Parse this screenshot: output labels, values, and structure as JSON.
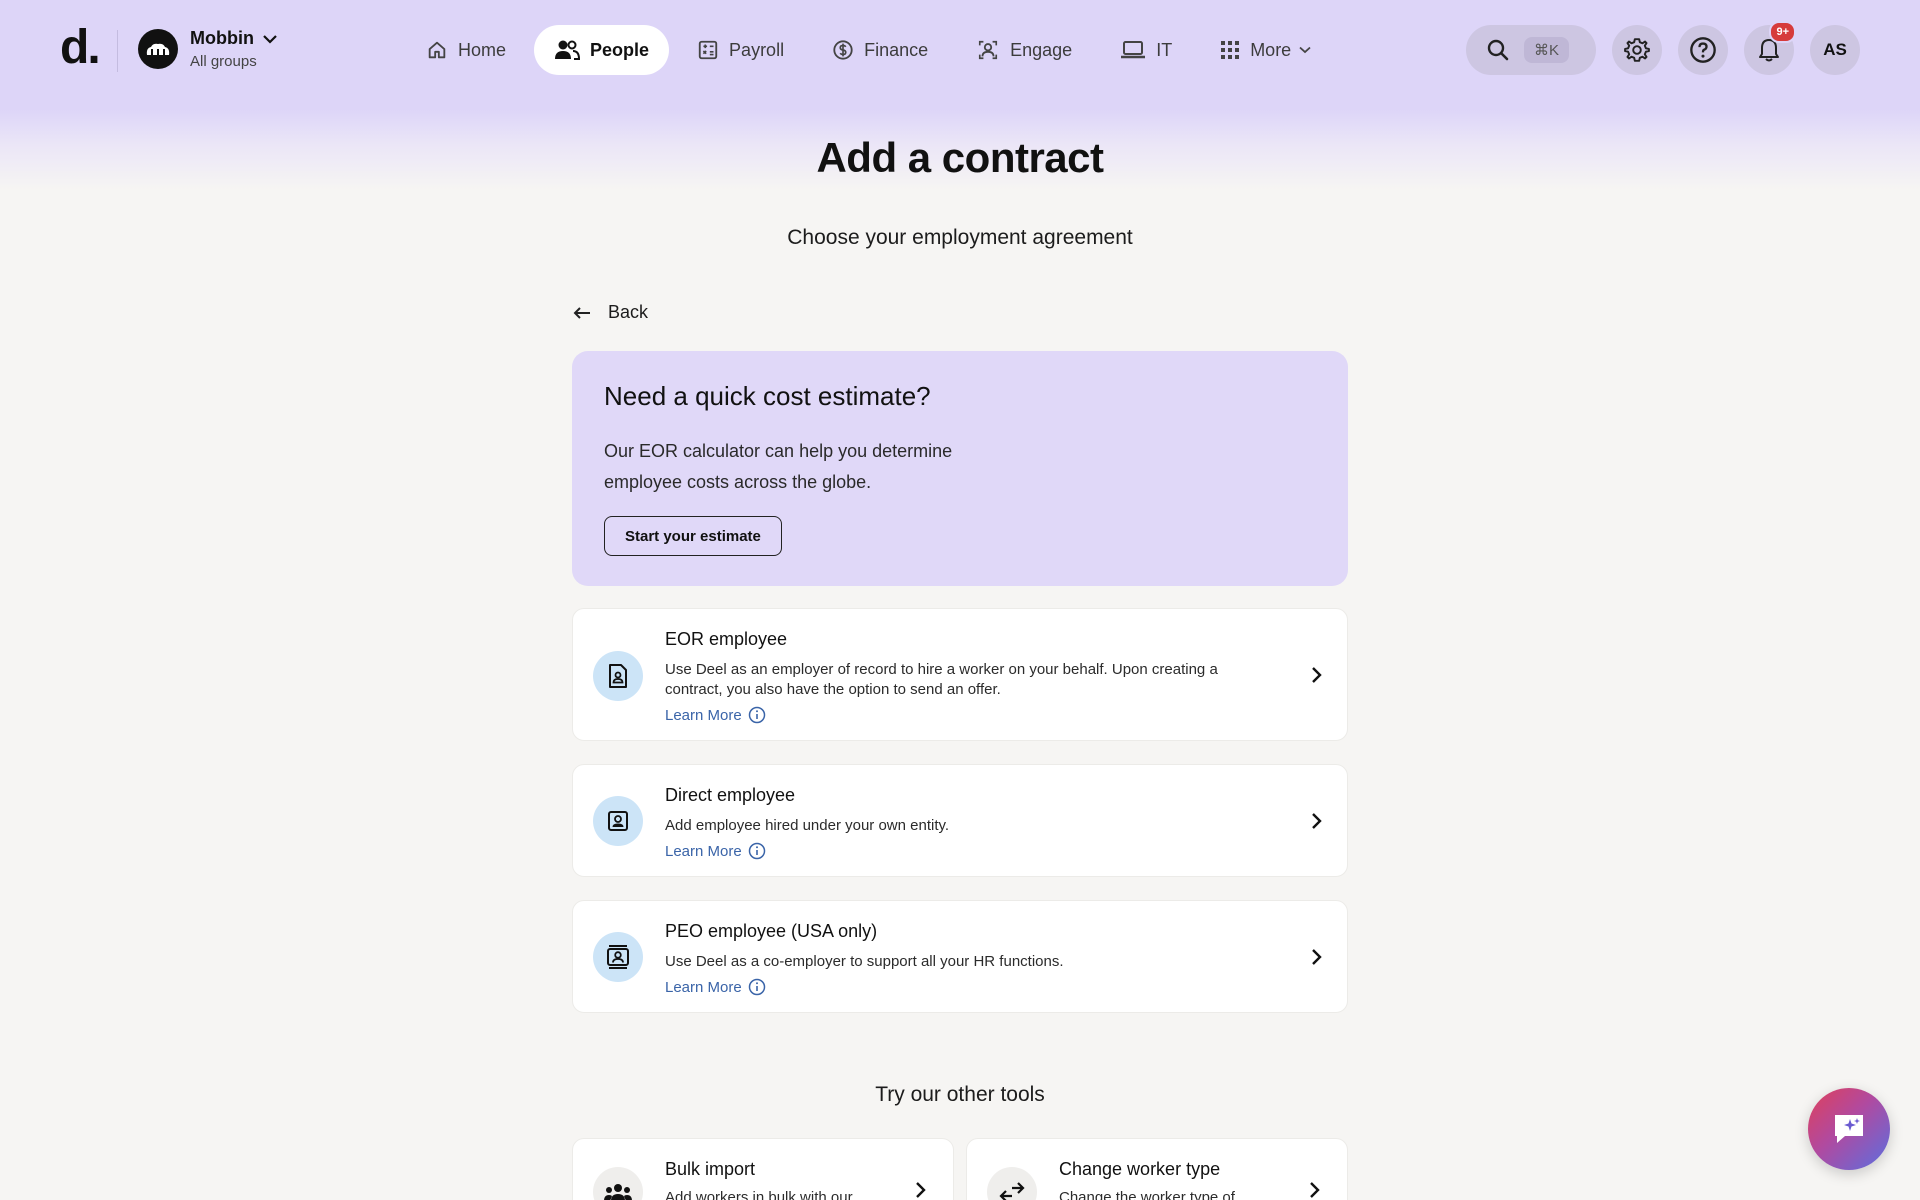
{
  "brand": {
    "logo": "d."
  },
  "org": {
    "name": "Mobbin",
    "sub": "All groups"
  },
  "nav": {
    "items": [
      {
        "label": "Home",
        "icon": "home-icon"
      },
      {
        "label": "People",
        "icon": "people-icon",
        "active": true
      },
      {
        "label": "Payroll",
        "icon": "calculator-icon"
      },
      {
        "label": "Finance",
        "icon": "dollar-icon"
      },
      {
        "label": "Engage",
        "icon": "engage-icon"
      },
      {
        "label": "IT",
        "icon": "laptop-icon"
      },
      {
        "label": "More",
        "icon": "grid-icon"
      }
    ]
  },
  "toolbar": {
    "search_shortcut": "⌘K",
    "notifications_badge": "9+",
    "avatar_initials": "AS"
  },
  "page": {
    "title": "Add a contract",
    "subtitle": "Choose your employment agreement",
    "back_label": "Back"
  },
  "estimate": {
    "title": "Need a quick cost estimate?",
    "body": "Our EOR calculator can help you determine employee costs across the globe.",
    "button_label": "Start your estimate"
  },
  "options": [
    {
      "title": "EOR employee",
      "description": "Use Deel as an employer of record to hire a worker on your behalf. Upon creating a contract, you also have the option to send an offer.",
      "learn_more": "Learn More"
    },
    {
      "title": "Direct employee",
      "description": "Add employee hired under your own entity.",
      "learn_more": "Learn More"
    },
    {
      "title": "PEO employee (USA only)",
      "description": "Use Deel as a co-employer to support all your HR functions.",
      "learn_more": "Learn More"
    }
  ],
  "other_tools": {
    "title": "Try our other tools",
    "items": [
      {
        "title": "Bulk import",
        "description": "Add workers in bulk with our"
      },
      {
        "title": "Change worker type",
        "description": "Change the worker type of"
      }
    ]
  },
  "colors": {
    "header_bg": "#ddd5f8",
    "estimate_bg": "#e0d8f8",
    "icon_bg": "#cce4f7",
    "link": "#3a64a8",
    "badge": "#d63b3b"
  }
}
